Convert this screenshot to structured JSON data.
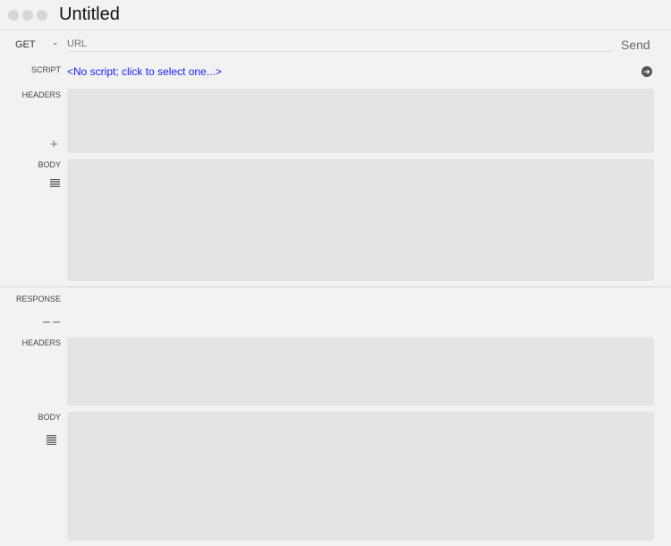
{
  "window": {
    "title": "Untitled"
  },
  "request": {
    "method": "GET",
    "url_placeholder": "URL",
    "send_label": "Send",
    "script_label": "SCRIPT",
    "script_value": "<No script; click to select one...>",
    "headers_label": "HEADERS",
    "body_label": "BODY"
  },
  "response": {
    "label": "RESPONSE",
    "headers_label": "HEADERS",
    "body_label": "BODY"
  },
  "colors": {
    "link": "#1a1aff"
  }
}
